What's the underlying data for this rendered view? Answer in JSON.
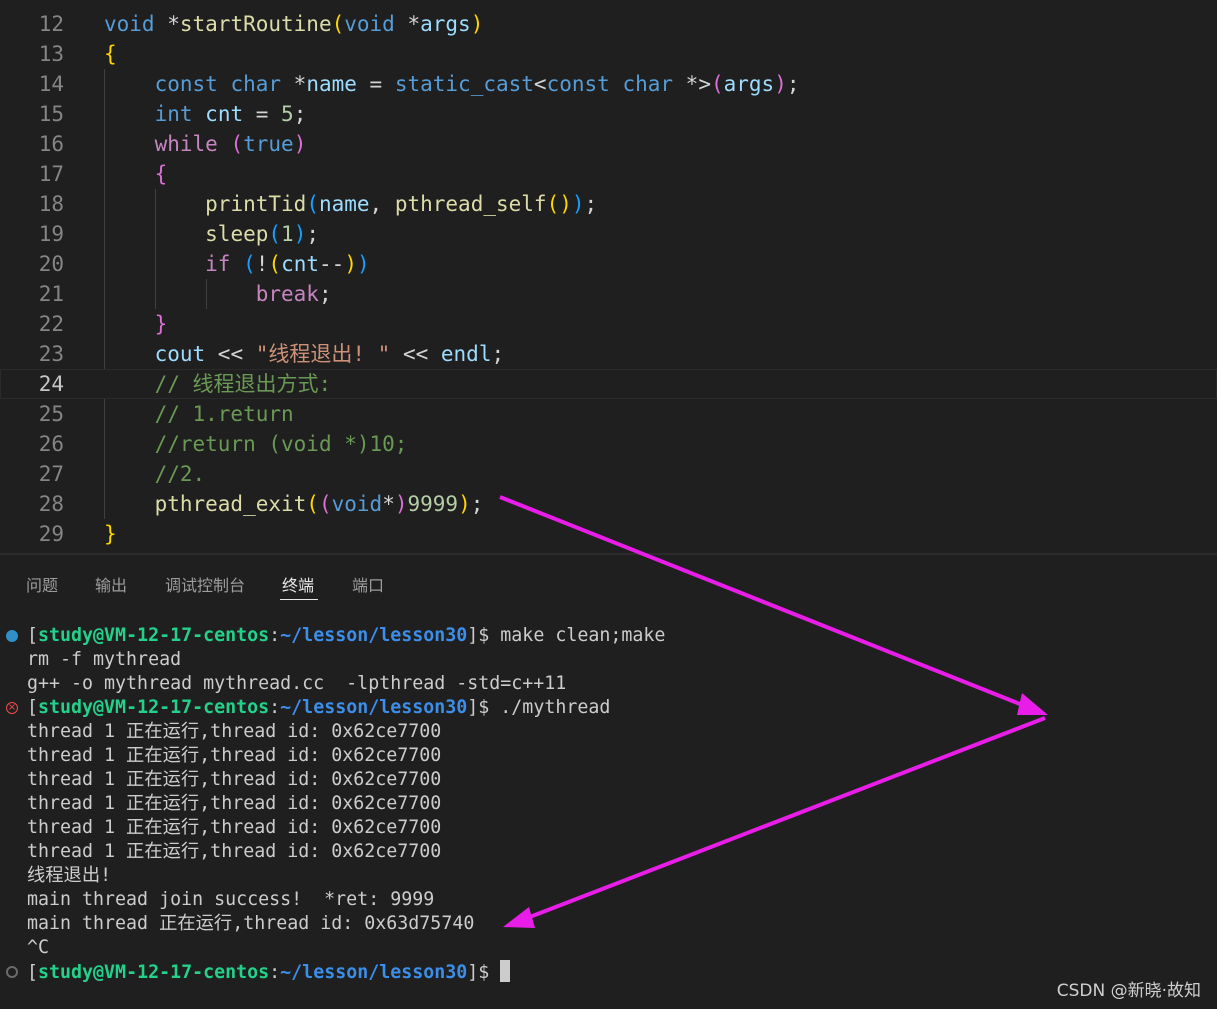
{
  "colors": {
    "kw": "#569cd6",
    "ctl": "#c586c0",
    "fn": "#dcdcaa",
    "var": "#9cdcfe",
    "num": "#b5cea8",
    "str": "#ce9178",
    "com": "#6a9955",
    "txt": "#d4d4d4",
    "b1": "#ffd700",
    "b2": "#da70d6",
    "b3": "#179fff",
    "green": "#23d18b",
    "path": "#3b8eea",
    "plain": "#cccccc",
    "arrow": "#e81ee8"
  },
  "editor": {
    "active_line": 24,
    "lines": [
      {
        "n": "12",
        "t": [
          [
            "void",
            "kw"
          ],
          [
            " *",
            "txt"
          ],
          [
            "startRoutine",
            "fn"
          ],
          [
            "(",
            "b1"
          ],
          [
            "void",
            "kw"
          ],
          [
            " *",
            "txt"
          ],
          [
            "args",
            "var"
          ],
          [
            ")",
            "b1"
          ]
        ]
      },
      {
        "n": "13",
        "t": [
          [
            "{",
            "b1"
          ]
        ]
      },
      {
        "n": "14",
        "t": [
          [
            "    ",
            "txt"
          ],
          [
            "const",
            "kw"
          ],
          [
            " ",
            "txt"
          ],
          [
            "char",
            "kw"
          ],
          [
            " *",
            "txt"
          ],
          [
            "name",
            "var"
          ],
          [
            " = ",
            "txt"
          ],
          [
            "static_cast",
            "kw"
          ],
          [
            "<",
            "txt"
          ],
          [
            "const",
            "kw"
          ],
          [
            " ",
            "txt"
          ],
          [
            "char",
            "kw"
          ],
          [
            " *>",
            "txt"
          ],
          [
            "(",
            "b2"
          ],
          [
            "args",
            "var"
          ],
          [
            ")",
            "b2"
          ],
          [
            ";",
            "txt"
          ]
        ]
      },
      {
        "n": "15",
        "t": [
          [
            "    ",
            "txt"
          ],
          [
            "int",
            "kw"
          ],
          [
            " ",
            "txt"
          ],
          [
            "cnt",
            "var"
          ],
          [
            " = ",
            "txt"
          ],
          [
            "5",
            "num"
          ],
          [
            ";",
            "txt"
          ]
        ]
      },
      {
        "n": "16",
        "t": [
          [
            "    ",
            "txt"
          ],
          [
            "while",
            "ctl"
          ],
          [
            " ",
            "txt"
          ],
          [
            "(",
            "b2"
          ],
          [
            "true",
            "kw"
          ],
          [
            ")",
            "b2"
          ]
        ]
      },
      {
        "n": "17",
        "t": [
          [
            "    ",
            "txt"
          ],
          [
            "{",
            "b2"
          ]
        ]
      },
      {
        "n": "18",
        "t": [
          [
            "        ",
            "txt"
          ],
          [
            "printTid",
            "fn"
          ],
          [
            "(",
            "b3"
          ],
          [
            "name",
            "var"
          ],
          [
            ", ",
            "txt"
          ],
          [
            "pthread_self",
            "fn"
          ],
          [
            "()",
            "b1"
          ],
          [
            ")",
            "b3"
          ],
          [
            ";",
            "txt"
          ]
        ]
      },
      {
        "n": "19",
        "t": [
          [
            "        ",
            "txt"
          ],
          [
            "sleep",
            "fn"
          ],
          [
            "(",
            "b3"
          ],
          [
            "1",
            "num"
          ],
          [
            ")",
            "b3"
          ],
          [
            ";",
            "txt"
          ]
        ]
      },
      {
        "n": "20",
        "t": [
          [
            "        ",
            "txt"
          ],
          [
            "if",
            "ctl"
          ],
          [
            " ",
            "txt"
          ],
          [
            "(",
            "b3"
          ],
          [
            "!",
            "txt"
          ],
          [
            "(",
            "b1"
          ],
          [
            "cnt",
            "var"
          ],
          [
            "--",
            "txt"
          ],
          [
            ")",
            "b1"
          ],
          [
            ")",
            "b3"
          ]
        ]
      },
      {
        "n": "21",
        "t": [
          [
            "            ",
            "txt"
          ],
          [
            "break",
            "ctl"
          ],
          [
            ";",
            "txt"
          ]
        ]
      },
      {
        "n": "22",
        "t": [
          [
            "    ",
            "txt"
          ],
          [
            "}",
            "b2"
          ]
        ]
      },
      {
        "n": "23",
        "t": [
          [
            "    ",
            "txt"
          ],
          [
            "cout",
            "var"
          ],
          [
            " << ",
            "txt"
          ],
          [
            "\"线程退出! \"",
            "str"
          ],
          [
            " << ",
            "txt"
          ],
          [
            "endl",
            "var"
          ],
          [
            ";",
            "txt"
          ]
        ]
      },
      {
        "n": "24",
        "t": [
          [
            "    ",
            "txt"
          ],
          [
            "// 线程退出方式:",
            "com"
          ]
        ]
      },
      {
        "n": "25",
        "t": [
          [
            "    ",
            "txt"
          ],
          [
            "// 1.return",
            "com"
          ]
        ]
      },
      {
        "n": "26",
        "t": [
          [
            "    ",
            "txt"
          ],
          [
            "//return (void *)10;",
            "com"
          ]
        ]
      },
      {
        "n": "27",
        "t": [
          [
            "    ",
            "txt"
          ],
          [
            "//2.",
            "com"
          ]
        ]
      },
      {
        "n": "28",
        "t": [
          [
            "    ",
            "txt"
          ],
          [
            "pthread_exit",
            "fn"
          ],
          [
            "(",
            "b1"
          ],
          [
            "(",
            "b2"
          ],
          [
            "void",
            "kw"
          ],
          [
            "*",
            "txt"
          ],
          [
            ")",
            "b2"
          ],
          [
            "9999",
            "num"
          ],
          [
            ")",
            "b1"
          ],
          [
            ";",
            "txt"
          ]
        ]
      },
      {
        "n": "29",
        "t": [
          [
            "}",
            "b1"
          ]
        ]
      }
    ]
  },
  "panel": {
    "tabs": [
      "问题",
      "输出",
      "调试控制台",
      "终端",
      "端口"
    ],
    "active_tab": 3,
    "terminal": [
      {
        "deco": "blue",
        "t": [
          [
            "[",
            "plain"
          ],
          [
            "study@VM-12-17-centos",
            "green"
          ],
          [
            ":",
            "plain"
          ],
          [
            "~/lesson/lesson30",
            "path"
          ],
          [
            "]$ make clean;make",
            "plain"
          ]
        ]
      },
      {
        "t": [
          [
            "rm -f mythread",
            "plain"
          ]
        ]
      },
      {
        "t": [
          [
            "g++ -o mythread mythread.cc  -lpthread -std=c++11",
            "plain"
          ]
        ]
      },
      {
        "deco": "err",
        "t": [
          [
            "[",
            "plain"
          ],
          [
            "study@VM-12-17-centos",
            "green"
          ],
          [
            ":",
            "plain"
          ],
          [
            "~/lesson/lesson30",
            "path"
          ],
          [
            "]$ ./mythread",
            "plain"
          ]
        ]
      },
      {
        "t": [
          [
            "thread 1 正在运行,thread id: 0x62ce7700",
            "plain"
          ]
        ]
      },
      {
        "t": [
          [
            "thread 1 正在运行,thread id: 0x62ce7700",
            "plain"
          ]
        ]
      },
      {
        "t": [
          [
            "thread 1 正在运行,thread id: 0x62ce7700",
            "plain"
          ]
        ]
      },
      {
        "t": [
          [
            "thread 1 正在运行,thread id: 0x62ce7700",
            "plain"
          ]
        ]
      },
      {
        "t": [
          [
            "thread 1 正在运行,thread id: 0x62ce7700",
            "plain"
          ]
        ]
      },
      {
        "t": [
          [
            "thread 1 正在运行,thread id: 0x62ce7700",
            "plain"
          ]
        ]
      },
      {
        "t": [
          [
            "线程退出!",
            "plain"
          ]
        ]
      },
      {
        "t": [
          [
            "main thread join success!  *ret: 9999",
            "plain"
          ]
        ]
      },
      {
        "t": [
          [
            "main thread 正在运行,thread id: 0x63d75740",
            "plain"
          ]
        ]
      },
      {
        "t": [
          [
            "^C",
            "plain"
          ]
        ]
      },
      {
        "deco": "empty",
        "cursor": true,
        "t": [
          [
            "[",
            "plain"
          ],
          [
            "study@VM-12-17-centos",
            "green"
          ],
          [
            ":",
            "plain"
          ],
          [
            "~/lesson/lesson30",
            "path"
          ],
          [
            "]$ ",
            "plain"
          ]
        ]
      }
    ]
  },
  "watermark": "CSDN @新晓·故知"
}
